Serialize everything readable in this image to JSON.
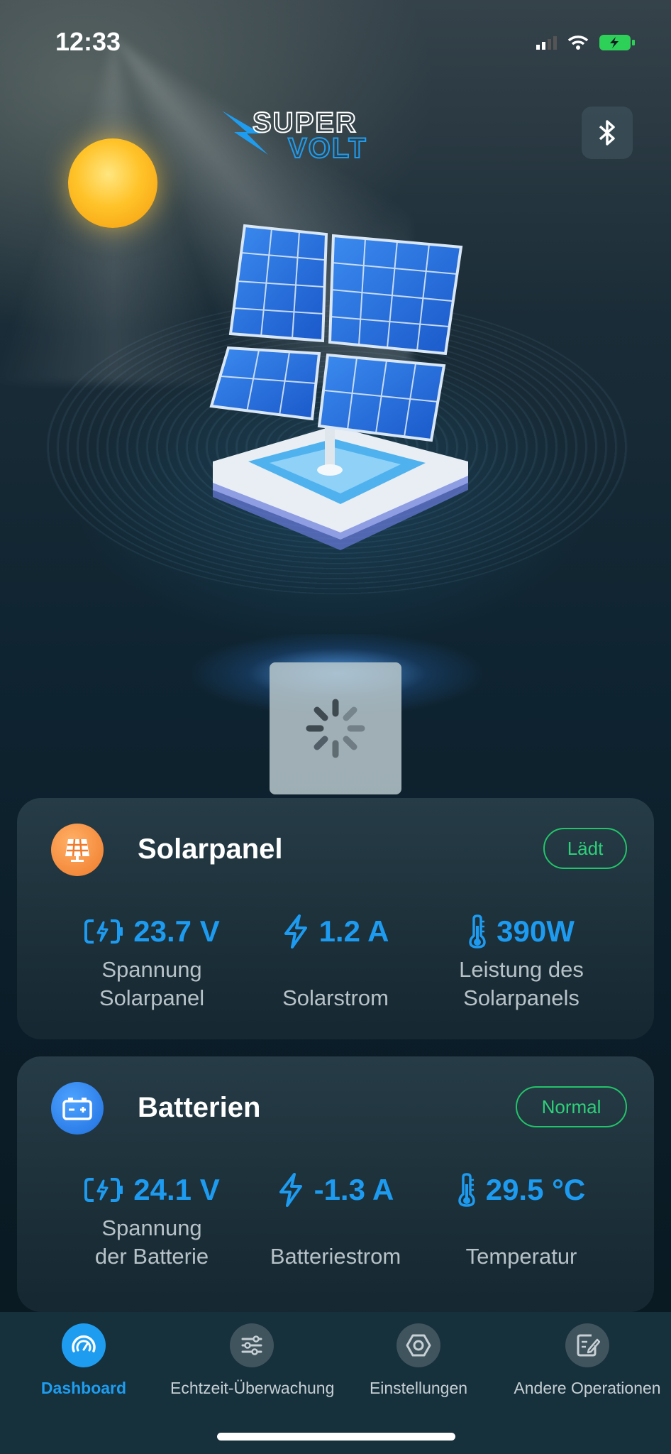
{
  "status_bar": {
    "time": "12:33"
  },
  "header": {
    "logo_text_top": "SUPER",
    "logo_text_bottom": "VOLT"
  },
  "solar": {
    "title": "Solarpanel",
    "badge": "Lädt",
    "metrics": [
      {
        "value": "23.7 V",
        "label": "Spannung\nSolarpanel",
        "icon": "battery-charge-icon"
      },
      {
        "value": "1.2 A",
        "label": "Solarstrom",
        "icon": "bolt-icon"
      },
      {
        "value": "390W",
        "label": "Leistung des\nSolarpanels",
        "icon": "thermometer-icon"
      }
    ]
  },
  "battery": {
    "title": "Batterien",
    "badge": "Normal",
    "metrics": [
      {
        "value": "24.1 V",
        "label": "Spannung\nder Batterie",
        "icon": "battery-charge-icon"
      },
      {
        "value": "-1.3 A",
        "label": "Batteriestrom",
        "icon": "bolt-icon"
      },
      {
        "value": "29.5 °C",
        "label": "Temperatur",
        "icon": "thermometer-icon"
      }
    ]
  },
  "tabs": [
    {
      "label": "Dashboard",
      "icon": "gauge-icon",
      "active": true
    },
    {
      "label": "Echtzeit-Überwachung",
      "icon": "sliders-icon",
      "active": false
    },
    {
      "label": "Einstellungen",
      "icon": "hex-nut-icon",
      "active": false
    },
    {
      "label": "Andere Operationen",
      "icon": "edit-document-icon",
      "active": false
    }
  ],
  "colors": {
    "accent": "#1e9df0",
    "badge_green": "#22c46a",
    "value_blue": "#1d9bf0"
  }
}
